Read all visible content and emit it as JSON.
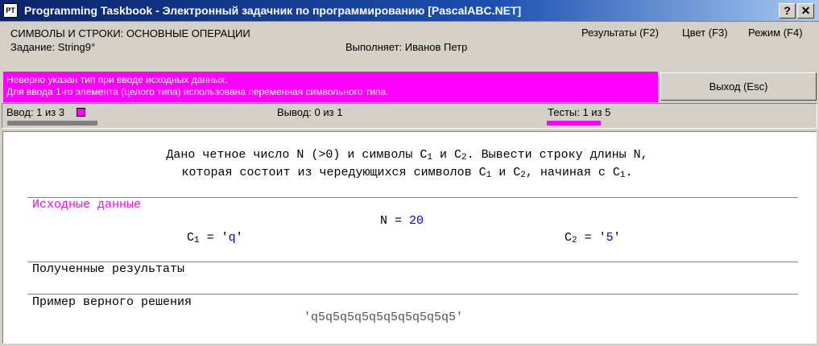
{
  "window": {
    "title": "Programming Taskbook - Электронный задачник по программированию [PascalABC.NET]",
    "icon_label": "PT",
    "help_label": "?",
    "close_label": "✕"
  },
  "header": {
    "group_title": "СИМВОЛЫ И СТРОКИ: ОСНОВНЫЕ ОПЕРАЦИИ",
    "task_label": "Задание: String9°",
    "performer_label": "Выполняет: Иванов Петр",
    "menu": {
      "results": "Результаты (F2)",
      "color": "Цвет (F3)",
      "mode": "Режим (F4)"
    }
  },
  "message": {
    "line1": "Неверно указан тип при вводе исходных данных.",
    "line2": "Для ввода 1-го элемента (целого типа) использована переменная символьного типа.",
    "color": "#ff00ff"
  },
  "exit_button": "Выход (Esc)",
  "status": {
    "input": "Ввод: 1 из 3",
    "input_progress": 0.33,
    "output": "Вывод: 0 из 1",
    "tests": "Тесты: 1 из 5",
    "tests_progress": 0.2
  },
  "task": {
    "line1": {
      "p1": "Дано четное число N (>0) и символы C",
      "s1": "1",
      "p2": " и C",
      "s2": "2",
      "p3": ". Вывести строку длины N,"
    },
    "line2": {
      "p1": "которая состоит из чередующихся символов C",
      "s1": "1",
      "p2": " и C",
      "s2": "2",
      "p3": ", начиная с C",
      "s3": "1",
      "p4": "."
    }
  },
  "input_section": {
    "title": "Исходные данные",
    "n_label": "N = ",
    "n_value": "20",
    "c1_label": "C",
    "c1_sub": "1",
    "c1_eq": " = '",
    "c1_value": "q",
    "c1_close": "'",
    "c2_label": "C",
    "c2_sub": "2",
    "c2_eq": " = '",
    "c2_value": "5",
    "c2_close": "'"
  },
  "results_section": {
    "title": "Полученные результаты"
  },
  "example_section": {
    "title": "Пример верного решения",
    "value": "'q5q5q5q5q5q5q5q5q5q5'"
  }
}
